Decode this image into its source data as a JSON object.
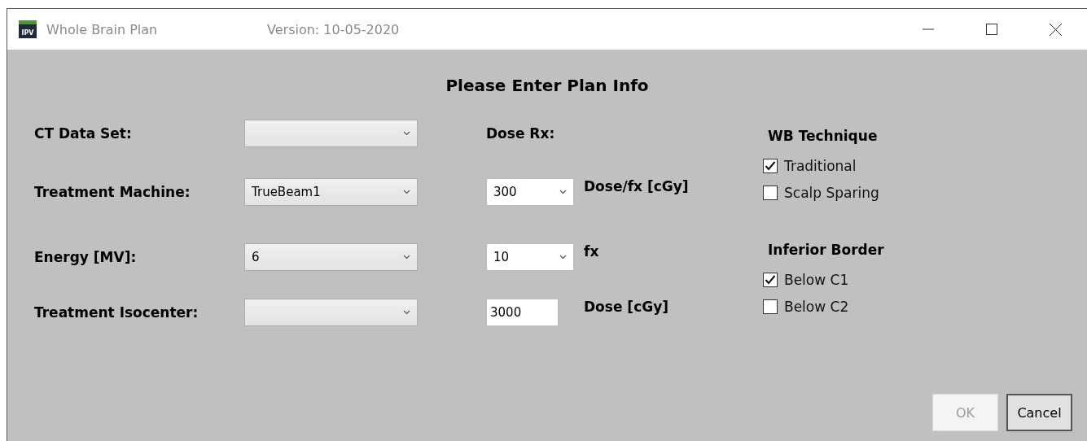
{
  "window": {
    "title": "Whole Brain Plan",
    "version": "Version: 10-05-2020",
    "icon_text": "IPV"
  },
  "heading": "Please Enter Plan Info",
  "fields": [
    {
      "label": "CT Data Set:"
    },
    {
      "label": "Treatment Machine:",
      "value": "TrueBeam1"
    },
    {
      "label": "Energy [MV]:",
      "value": "6"
    },
    {
      "label": "Treatment Isocenter:"
    }
  ],
  "dose_rx": {
    "label": "Dose Rx:",
    "rows": [
      {
        "kind": "dropdown",
        "value": "300",
        "label": "Dose/fx [cGy]"
      },
      {
        "kind": "dropdown",
        "value": "10",
        "label": "fx"
      },
      {
        "kind": "input",
        "value": "3000",
        "label": "Dose [cGy]"
      }
    ]
  },
  "groups": [
    {
      "title": "WB Technique",
      "options": [
        {
          "label": "Traditional",
          "checked": true
        },
        {
          "label": "Scalp Sparing",
          "checked": false
        }
      ]
    },
    {
      "title": "Inferior Border",
      "options": [
        {
          "label": "Below C1",
          "checked": true
        },
        {
          "label": "Below C2",
          "checked": false
        }
      ]
    }
  ],
  "buttons": [
    {
      "label": "OK",
      "disabled": true
    },
    {
      "label": "Cancel",
      "disabled": false
    }
  ]
}
